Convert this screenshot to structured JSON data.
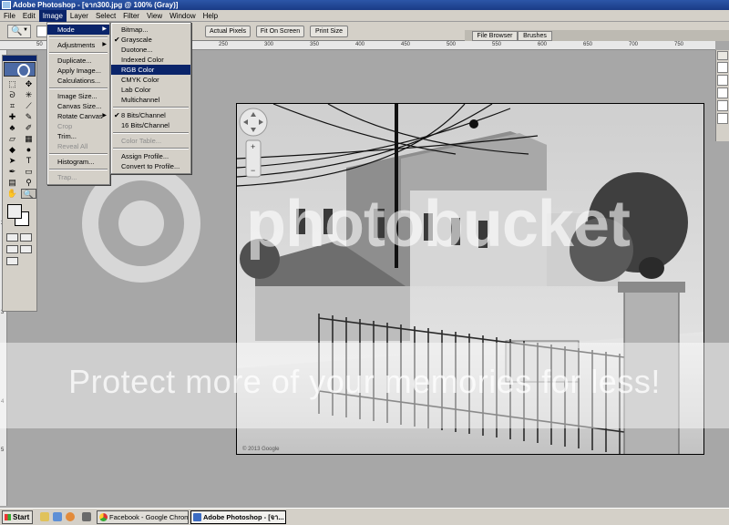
{
  "window": {
    "title": "Adobe Photoshop - [จาก300.jpg @ 100% (Gray)]"
  },
  "menubar": [
    "File",
    "Edit",
    "Image",
    "Layer",
    "Select",
    "Filter",
    "View",
    "Window",
    "Help"
  ],
  "options": {
    "buttons": [
      "Actual Pixels",
      "Fit On Screen",
      "Print Size"
    ],
    "palette_tabs": [
      "File Browser",
      "Brushes"
    ]
  },
  "ruler": {
    "h": [
      "50",
      "100",
      "150",
      "200",
      "250",
      "300",
      "350",
      "400",
      "450",
      "500",
      "550",
      "600",
      "650",
      "700",
      "750"
    ],
    "v": [
      "2",
      "3",
      "4",
      "5"
    ]
  },
  "image_menu": {
    "items": [
      {
        "label": "Mode"
      },
      {
        "label": "Adjustments"
      },
      {
        "label": "Duplicate..."
      },
      {
        "label": "Apply Image..."
      },
      {
        "label": "Calculations..."
      },
      {
        "label": "Image Size..."
      },
      {
        "label": "Canvas Size..."
      },
      {
        "label": "Rotate Canvas"
      },
      {
        "label": "Crop"
      },
      {
        "label": "Trim..."
      },
      {
        "label": "Reveal All"
      },
      {
        "label": "Histogram..."
      },
      {
        "label": "Trap..."
      }
    ]
  },
  "mode_menu": {
    "items": [
      {
        "label": "Bitmap..."
      },
      {
        "label": "Grayscale"
      },
      {
        "label": "Duotone..."
      },
      {
        "label": "Indexed Color"
      },
      {
        "label": "RGB Color"
      },
      {
        "label": "CMYK Color"
      },
      {
        "label": "Lab Color"
      },
      {
        "label": "Multichannel"
      },
      {
        "label": "8 Bits/Channel"
      },
      {
        "label": "16 Bits/Channel"
      },
      {
        "label": "Color Table..."
      },
      {
        "label": "Assign Profile..."
      },
      {
        "label": "Convert to Profile..."
      }
    ],
    "check_mark": "✔"
  },
  "watermark": {
    "logo": "photobucket",
    "tagline": "Protect more of your memories for less!"
  },
  "photo_caption": "© 2013 Google",
  "taskbar": {
    "start": "Start",
    "tasks": [
      "Facebook - Google Chrome",
      "Adobe Photoshop - [จา..."
    ]
  },
  "colors": {
    "menu_highlight": "#0a246a",
    "title_bar": "#1a3b86",
    "chrome": "#d4d0c8"
  }
}
